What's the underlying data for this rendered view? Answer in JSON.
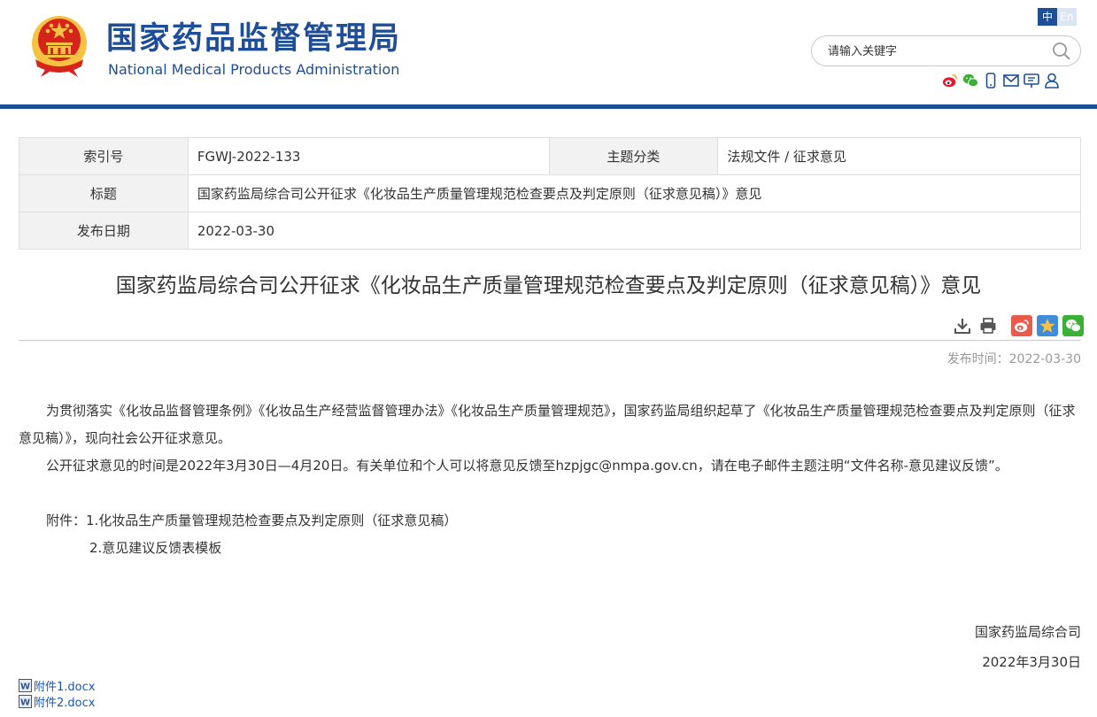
{
  "header": {
    "site_name_cn": "国家药品监督管理局",
    "site_name_en": "National Medical Products Administration",
    "lang_cn": "中",
    "lang_en": "En",
    "search_placeholder": "请输入关键字",
    "social_icons": [
      "weibo-icon",
      "wechat-icon",
      "mobile-icon",
      "mail-icon",
      "feedback-icon",
      "user-icon"
    ],
    "brand_color": "#1f4e98"
  },
  "info_table": {
    "index_label": "索引号",
    "index_value": "FGWJ-2022-133",
    "topic_label": "主题分类",
    "topic_value": "法规文件 / 征求意见",
    "title_label": "标题",
    "title_value": "国家药监局综合司公开征求《化妆品生产质量管理规范检查要点及判定原则（征求意见稿）》意见",
    "date_label": "发布日期",
    "date_value": "2022-03-30"
  },
  "article": {
    "title": "国家药监局综合司公开征求《化妆品生产质量管理规范检查要点及判定原则（征求意见稿）》意见",
    "tool_icons": [
      "download-icon",
      "print-icon",
      "share-weibo-icon",
      "share-qzone-icon",
      "share-wechat-icon"
    ],
    "publish_time": "发布时间：2022-03-30",
    "paragraph1": "为贯彻落实《化妆品监督管理条例》《化妆品生产经营监督管理办法》《化妆品生产质量管理规范》，国家药监局组织起草了《化妆品生产质量管理规范检查要点及判定原则（征求意见稿）》，现向社会公开征求意见。",
    "paragraph2": "公开征求意见的时间是2022年3月30日—4月20日。有关单位和个人可以将意见反馈至hzpjgc@nmpa.gov.cn，请在电子邮件主题注明“文件名称-意见建议反馈”。",
    "attachment1": "附件：1.化妆品生产质量管理规范检查要点及判定原则（征求意见稿）",
    "attachment2": "2.意见建议反馈表模板",
    "sign_org": "国家药监局综合司",
    "sign_date": "2022年3月30日"
  },
  "files": [
    {
      "name": "附件1.docx"
    },
    {
      "name": "附件2.docx"
    }
  ]
}
